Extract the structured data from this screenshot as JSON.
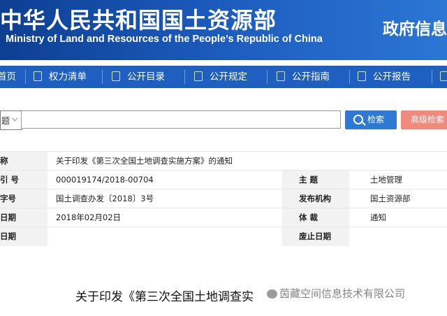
{
  "header": {
    "title_cn": "中华人民共和国国土资源部",
    "title_en": "Ministry of Land and Resources of the People’s Republic of China",
    "right_title": "政府信息"
  },
  "nav": {
    "items": [
      {
        "label": "首页",
        "icon": "home-icon"
      },
      {
        "label": "权力清单",
        "icon": "list-icon"
      },
      {
        "label": "公开目录",
        "icon": "catalog-icon"
      },
      {
        "label": "公开规定",
        "icon": "document-icon"
      },
      {
        "label": "公开指南",
        "icon": "guide-icon"
      },
      {
        "label": "公开报告",
        "icon": "report-icon"
      }
    ]
  },
  "search": {
    "select_value": "题",
    "input_value": "",
    "search_button": "检索",
    "advanced_button": "高级检索"
  },
  "meta": {
    "name_label": "称",
    "name_value": "关于印发《第三次全国土地调查实施方案》的通知",
    "index_label": "引  号",
    "index_value": "000019174/2018-00704",
    "subject_label": "主      题",
    "subject_value": "土地管理",
    "doc_no_label": "字号",
    "doc_no_value": "国土调查办发〔2018〕3号",
    "issuer_label": "发布机构",
    "issuer_value": "国土资源部",
    "date_label": "日期",
    "date_value": "2018年02月02日",
    "genre_label": "体      裁",
    "genre_value": "通知",
    "expire_label": "日期",
    "expire_value": "",
    "abolish_label": "废止日期",
    "abolish_value": ""
  },
  "document": {
    "title": "关于印发《第三次全国土地调查实"
  },
  "watermark": {
    "text": "茵藏空间信息技术有限公司"
  }
}
